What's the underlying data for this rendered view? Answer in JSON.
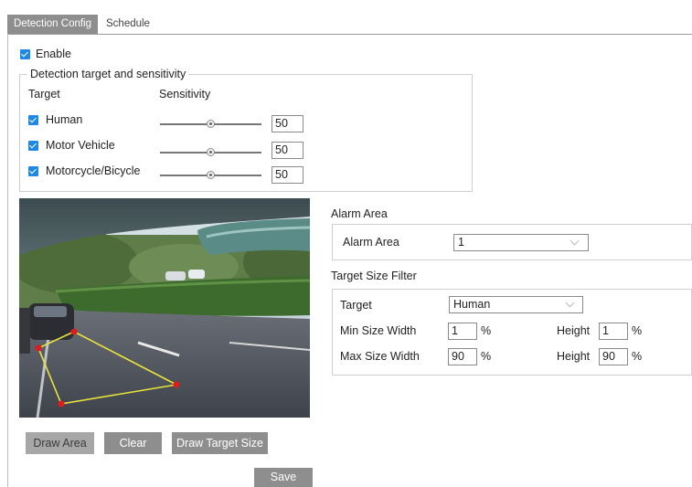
{
  "tabs": [
    {
      "label": "Detection Config",
      "active": true
    },
    {
      "label": "Schedule",
      "active": false
    }
  ],
  "enable": {
    "label": "Enable",
    "checked": true
  },
  "sensitivity_group": {
    "legend": "Detection target and sensitivity",
    "col_target": "Target",
    "col_sensitivity": "Sensitivity",
    "rows": [
      {
        "label": "Human",
        "checked": true,
        "value": "50",
        "slider_fraction": 0.5
      },
      {
        "label": "Motor Vehicle",
        "checked": true,
        "value": "50",
        "slider_fraction": 0.5
      },
      {
        "label": "Motorcycle/Bicycle",
        "checked": true,
        "value": "50",
        "slider_fraction": 0.5
      }
    ]
  },
  "alarm_area": {
    "section_title": "Alarm Area",
    "label": "Alarm Area",
    "value": "1"
  },
  "target_size_filter": {
    "section_title": "Target Size Filter",
    "target_label": "Target",
    "target_value": "Human",
    "min_label": "Min Size Width",
    "min_width": "1",
    "min_height_label": "Height",
    "min_height": "1",
    "max_label": "Max Size Width",
    "max_width": "90",
    "max_height_label": "Height",
    "max_height": "90",
    "unit": "%"
  },
  "buttons": {
    "draw_area": "Draw Area",
    "clear": "Clear",
    "draw_target_size": "Draw Target Size",
    "save": "Save"
  },
  "colors": {
    "accent_checkbox": "#1e88e5",
    "tab_active_bg": "#8e8e8e",
    "button_bg": "#8e8e8e",
    "area_line": "#e8e43a",
    "area_vertex": "#e01b1b"
  }
}
